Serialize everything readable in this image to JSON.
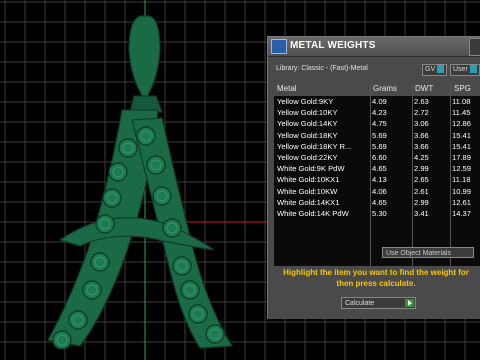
{
  "panel": {
    "title": "METAL WEIGHTS",
    "library": "Library: Classic - (Fast)-Metal",
    "toggles": [
      {
        "label": "GV"
      },
      {
        "label": "User"
      }
    ],
    "columns": [
      "Metal",
      "Grams",
      "DWT",
      "SPG"
    ],
    "rows": [
      [
        "Yellow Gold:9KY",
        "4.09",
        "2.63",
        "11.08"
      ],
      [
        "Yellow Gold:10KY",
        "4.23",
        "2.72",
        "11.45"
      ],
      [
        "Yellow Gold:14KY",
        "4.75",
        "3.06",
        "12.86"
      ],
      [
        "Yellow Gold:18KY",
        "5.69",
        "3.66",
        "15.41"
      ],
      [
        "Yellow Gold:18KY R...",
        "5.69",
        "3.66",
        "15.41"
      ],
      [
        "Yellow Gold:22KY",
        "6.60",
        "4.25",
        "17.89"
      ],
      [
        "White Gold:9K PdW",
        "4.65",
        "2.99",
        "12.59"
      ],
      [
        "White Gold:10KX1",
        "4.13",
        "2.65",
        "11.18"
      ],
      [
        "White Gold:10KW",
        "4.06",
        "2.61",
        "10.99"
      ],
      [
        "White Gold:14KX1",
        "4.65",
        "2.99",
        "12.61"
      ],
      [
        "White Gold:14K PdW",
        "5.30",
        "3.41",
        "14.37"
      ]
    ],
    "use_object_materials": "Use Object Materials",
    "hint": "Highlight the item you want to find the weight for then press calculate.",
    "calculate": "Calculate"
  },
  "colors": {
    "pendant": "#1a6a45",
    "grid": "#3a3a3a",
    "hint": "#f5c800"
  }
}
